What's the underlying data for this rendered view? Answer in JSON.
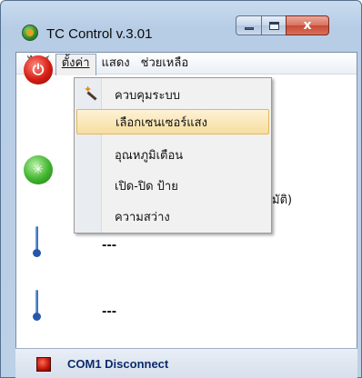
{
  "window": {
    "title": "TC  Control v.3.01",
    "icon": "app-logo-icon",
    "close_glyph": "x"
  },
  "menubar": {
    "items": [
      {
        "label": "ไฟล์"
      },
      {
        "label": "ตั้งค่า"
      },
      {
        "label": "แสดง"
      },
      {
        "label": "ช่วยเหลือ"
      }
    ]
  },
  "dropdown": {
    "items": [
      {
        "label": "ควบคุมระบบ",
        "icon": "magic-wand-icon"
      },
      {
        "label": "เลือกเซนเซอร์แสง",
        "highlighted": true
      },
      {
        "label": "อุณหภูมิเตือน"
      },
      {
        "label": "เปิด-ปิด ป้าย"
      },
      {
        "label": "ความสว่าง"
      }
    ]
  },
  "main": {
    "partial_text": "มัติ)",
    "thermometer_1_value": "---",
    "thermometer_2_value": "---"
  },
  "statusbar": {
    "text": "COM1  Disconnect",
    "status_color": "#d0190c"
  },
  "colors": {
    "highlight": "#f7dea0",
    "menu_bg": "#f1f1f1"
  }
}
